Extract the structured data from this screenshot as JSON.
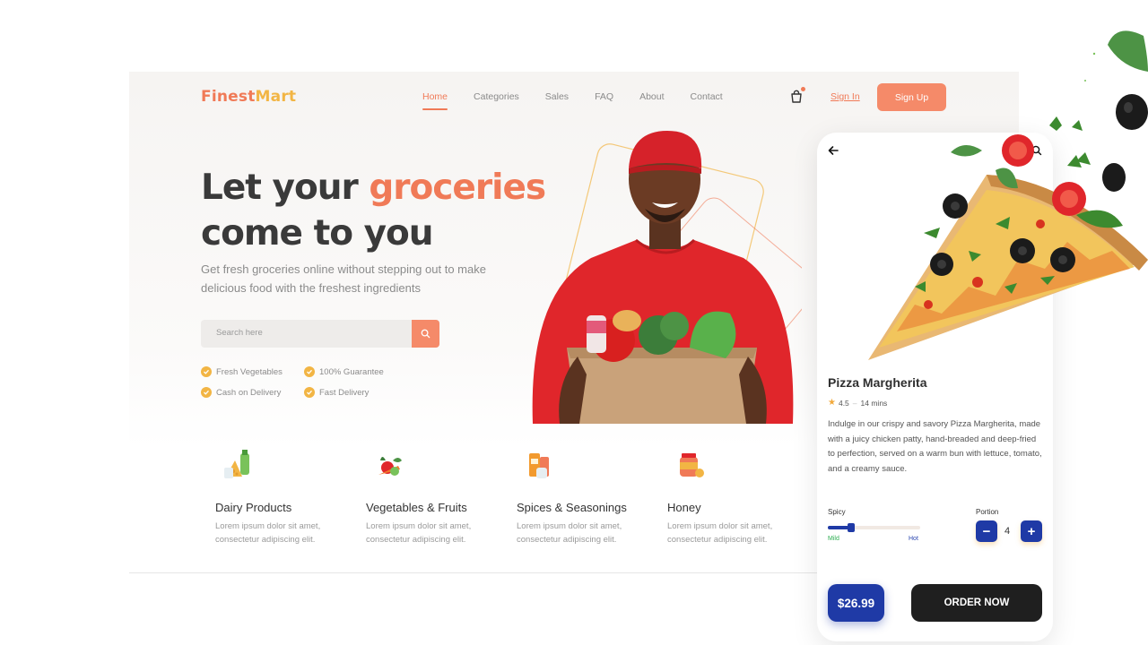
{
  "brand": {
    "part1": "Finest",
    "part2": "Mart"
  },
  "nav": {
    "items": [
      "Home",
      "Categories",
      "Sales",
      "FAQ",
      "About",
      "Contact"
    ],
    "active": "Home"
  },
  "auth": {
    "signin": "Sign In",
    "signup": "Sign Up"
  },
  "hero": {
    "title_line1_a": "Let your ",
    "title_line1_b": "groceries",
    "title_line2": "come to you",
    "subtitle": "Get fresh groceries online without stepping out to make delicious food with the freshest ingredients",
    "search_placeholder": "Search here",
    "features": [
      "Fresh Vegetables",
      "100% Guarantee",
      "Cash on Delivery",
      "Fast Delivery"
    ]
  },
  "categories": [
    {
      "title": "Dairy Products",
      "desc": "Lorem ipsum dolor sit amet, consectetur adipiscing elit."
    },
    {
      "title": "Vegetables & Fruits",
      "desc": "Lorem ipsum dolor sit amet, consectetur adipiscing elit."
    },
    {
      "title": "Spices & Seasonings",
      "desc": "Lorem ipsum dolor sit amet, consectetur adipiscing elit."
    },
    {
      "title": "Honey",
      "desc": "Lorem ipsum dolor sit amet, consectetur adipiscing elit."
    }
  ],
  "product": {
    "name": "Pizza Margherita",
    "rating": "4.5",
    "time": "14 mins",
    "description": "Indulge in our crispy and savory Pizza Margherita, made with a juicy chicken patty, hand-breaded and deep-fried to perfection, served on a warm bun with lettuce, tomato, and a creamy sauce.",
    "spicy_label": "Spicy",
    "spicy_min": "Mild",
    "spicy_max": "Hot",
    "spicy_level": 0.25,
    "portion_label": "Portion",
    "portion": "4",
    "price": "$26.99",
    "order_label": "ORDER NOW"
  },
  "colors": {
    "accent": "#f07a57",
    "accent_light": "#f58a69",
    "brand_yellow": "#f2b544",
    "blue": "#1f3aa6",
    "dark": "#1f1f1f"
  },
  "icons": [
    "cart-icon",
    "search-icon",
    "check-icon",
    "back-arrow-icon",
    "dairy-icon",
    "vegetables-icon",
    "spices-icon",
    "honey-icon",
    "star-icon",
    "minus-icon",
    "plus-icon"
  ]
}
